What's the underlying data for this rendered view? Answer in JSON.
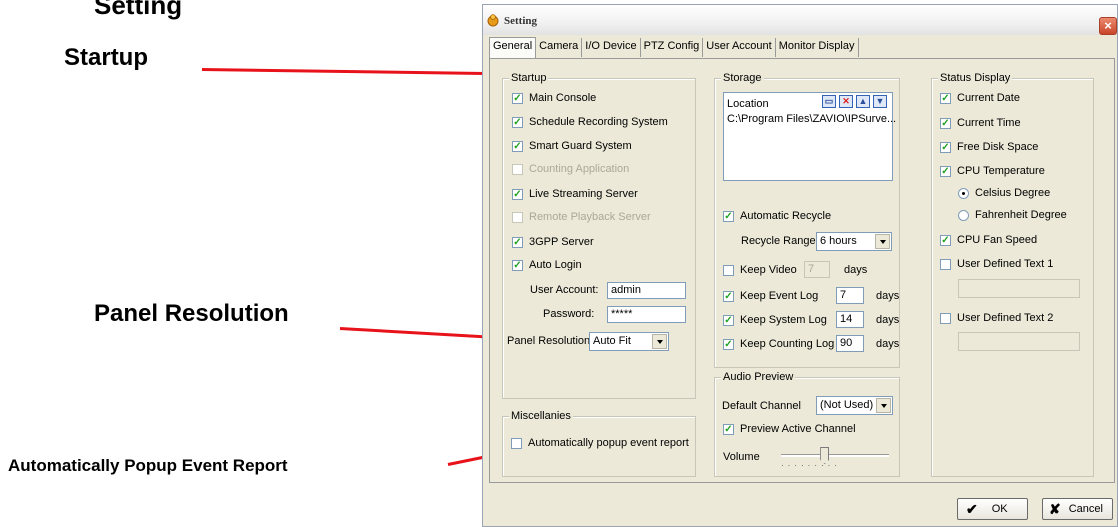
{
  "annotations": {
    "setting_heading": "Setting",
    "startup": "Startup",
    "panel_resolution": "Panel Resolution",
    "auto_popup": "Automatically Popup Event Report",
    "line_color": "#e8131a"
  },
  "window": {
    "title": "Setting",
    "close_glyph": "×"
  },
  "tabs": [
    {
      "label": "General",
      "active": true
    },
    {
      "label": "Camera"
    },
    {
      "label": "I/O Device"
    },
    {
      "label": "PTZ Config"
    },
    {
      "label": "User Account"
    },
    {
      "label": "Monitor Display"
    }
  ],
  "startup": {
    "legend": "Startup",
    "items": [
      {
        "label": "Main Console",
        "checked": true
      },
      {
        "label": "Schedule Recording System",
        "checked": true
      },
      {
        "label": "Smart Guard System",
        "checked": true
      },
      {
        "label": "Counting Application",
        "checked": false,
        "disabled": true
      },
      {
        "label": "Live Streaming Server",
        "checked": true
      },
      {
        "label": "Remote Playback Server",
        "checked": false,
        "disabled": true
      },
      {
        "label": "3GPP Server",
        "checked": true
      },
      {
        "label": "Auto Login",
        "checked": true
      }
    ],
    "user_account_label": "User Account:",
    "user_account_value": "admin",
    "password_label": "Password:",
    "password_value": "*****",
    "panel_resolution_label": "Panel Resolution",
    "panel_resolution_value": "Auto Fit"
  },
  "miscellanies": {
    "legend": "Miscellanies",
    "auto_popup_label": "Automatically popup event report",
    "auto_popup_checked": false
  },
  "storage": {
    "legend": "Storage",
    "list_header": "Location",
    "locations": [
      "C:\\Program Files\\ZAVIO\\IPSurve..."
    ],
    "automatic_recycle_label": "Automatic Recycle",
    "automatic_recycle_checked": true,
    "recycle_range_label": "Recycle Range",
    "recycle_range_value": "6 hours",
    "keep_video_label": "Keep Video",
    "keep_video_value": "7",
    "keep_video_checked": false,
    "keep_event_log_label": "Keep Event Log",
    "keep_event_log_value": "7",
    "keep_system_log_label": "Keep System Log",
    "keep_system_log_value": "14",
    "keep_counting_log_label": "Keep Counting Log",
    "keep_counting_log_value": "90",
    "days": "days"
  },
  "audio": {
    "legend": "Audio Preview",
    "default_channel_label": "Default Channel",
    "default_channel_value": "(Not Used)",
    "preview_active_label": "Preview Active Channel",
    "preview_active_checked": true,
    "volume_label": "Volume",
    "volume_level": 0.4
  },
  "status": {
    "legend": "Status Display",
    "current_date": "Current Date",
    "current_time": "Current Time",
    "free_disk_space": "Free Disk Space",
    "cpu_temperature": "CPU Temperature",
    "celsius": "Celsius Degree",
    "fahrenheit": "Fahrenheit Degree",
    "cpu_fan_speed": "CPU Fan Speed",
    "user_text_1": "User Defined Text 1",
    "user_text_2": "User Defined Text 2"
  },
  "buttons": {
    "ok": "OK",
    "cancel": "Cancel",
    "ok_glyph": "✔",
    "cancel_glyph": "✘"
  },
  "check_glyph": "✓"
}
